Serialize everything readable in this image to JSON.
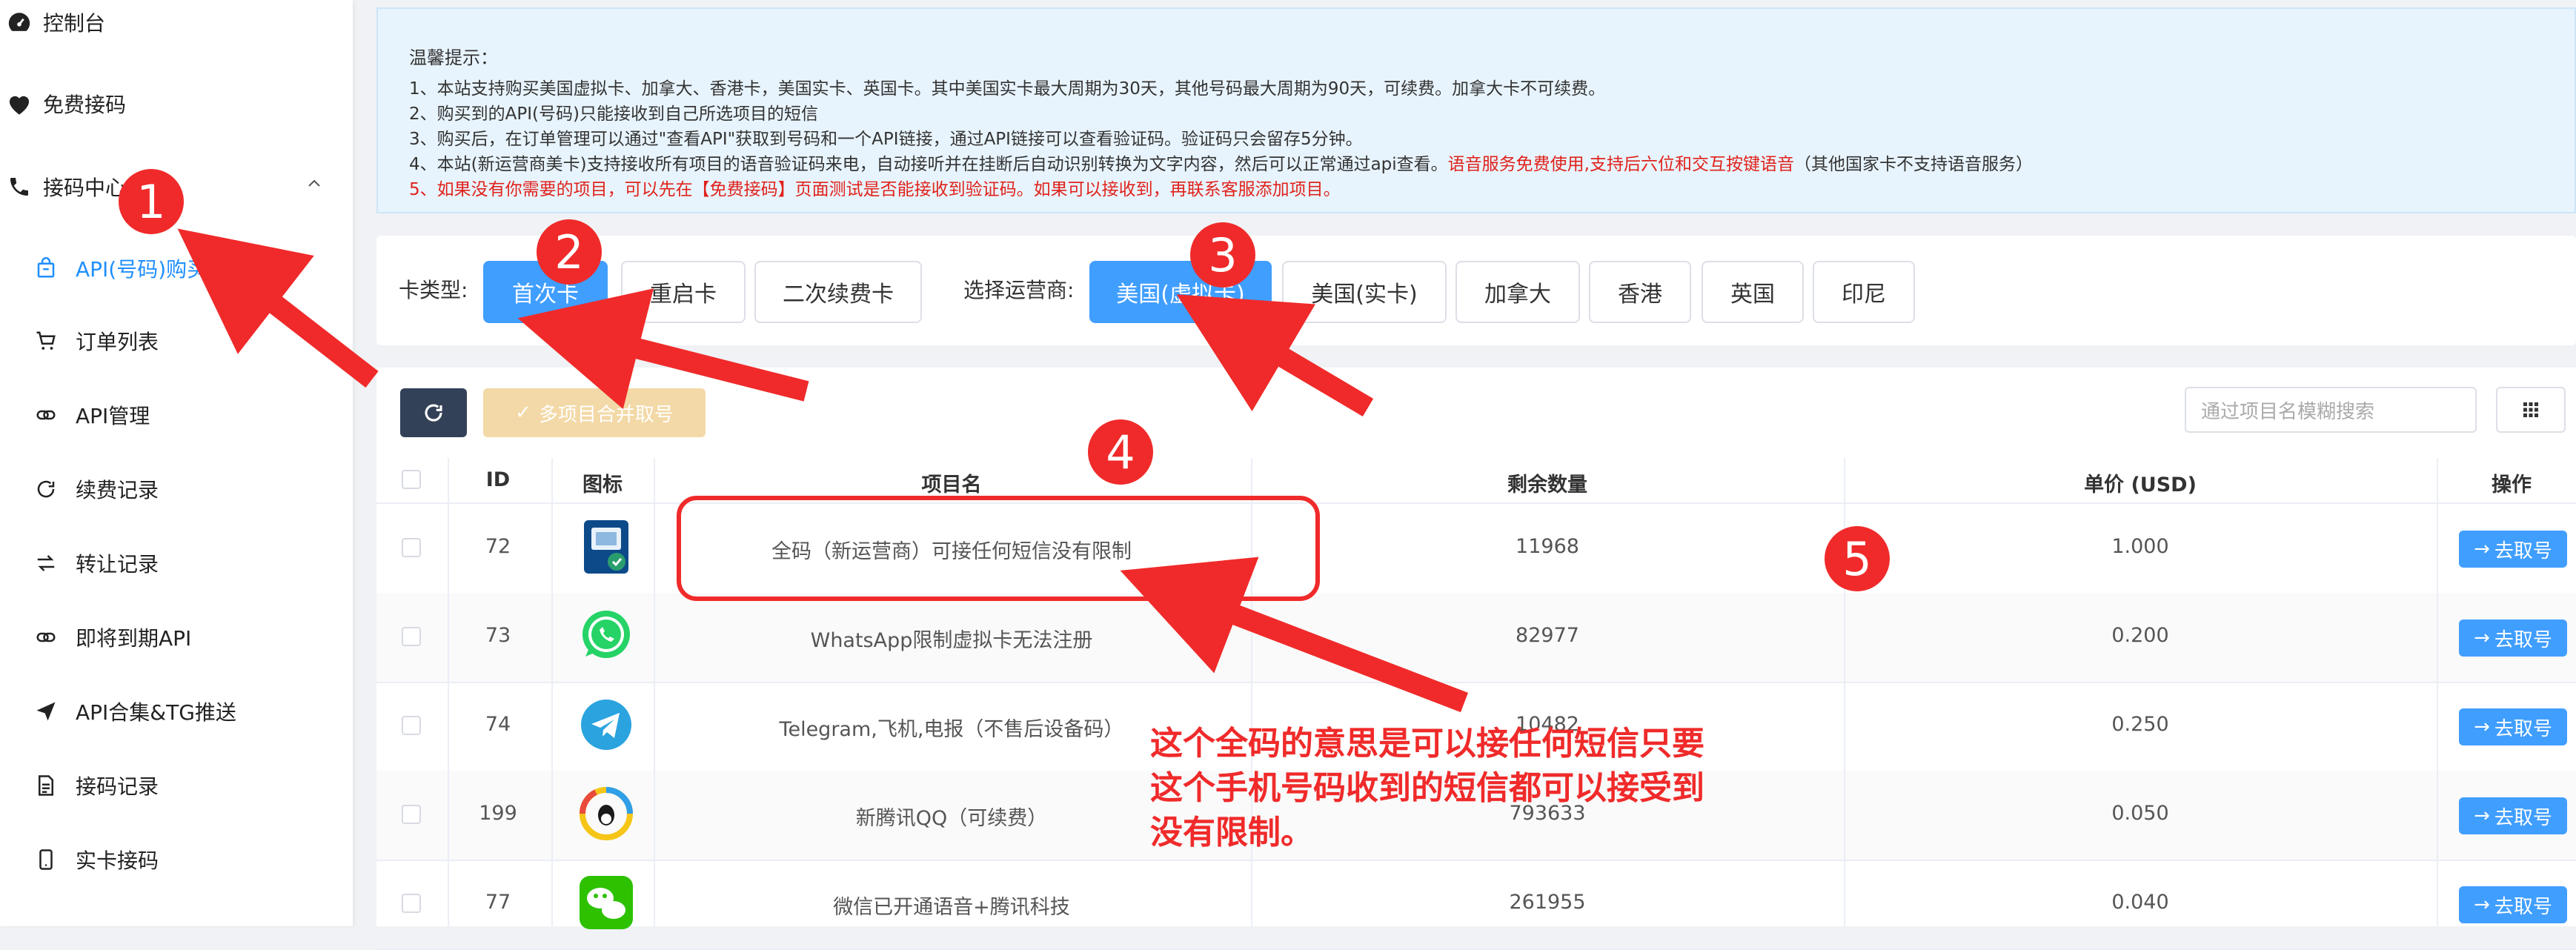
{
  "sidebar": {
    "items": [
      {
        "label": "控制台",
        "icon": "dashboard-icon"
      },
      {
        "label": "免费接码",
        "icon": "heart-icon"
      },
      {
        "label": "接码中心",
        "icon": "phone-icon"
      },
      {
        "label": "API(号码)购买",
        "icon": "bag-icon"
      },
      {
        "label": "订单列表",
        "icon": "cart-icon"
      },
      {
        "label": "API管理",
        "icon": "link-icon"
      },
      {
        "label": "续费记录",
        "icon": "refresh-icon"
      },
      {
        "label": "转让记录",
        "icon": "transfer-icon"
      },
      {
        "label": "即将到期API",
        "icon": "link-icon"
      },
      {
        "label": "API合集&TG推送",
        "icon": "send-icon"
      },
      {
        "label": "接码记录",
        "icon": "document-icon"
      },
      {
        "label": "实卡接码",
        "icon": "mobile-icon"
      }
    ]
  },
  "notice": {
    "title": "温馨提示：",
    "lines": [
      "1、本站支持购买美国虚拟卡、加拿大、香港卡，美国实卡、英国卡。其中美国实卡最大周期为30天，其他号码最大周期为90天，可续费。加拿大卡不可续费。",
      "2、购买到的API(号码)只能接收到自己所选项目的短信",
      "3、购买后，在订单管理可以通过\"查看API\"获取到号码和一个API链接，通过API链接可以查看验证码。验证码只会留存5分钟。",
      "4、本站(新运营商美卡)支持接收所有项目的语音验证码来电，自动接听并在挂断后自动识别转换为文字内容，然后可以正常通过api查看。",
      "5、如果没有你需要的项目，可以先在【免费接码】页面测试是否能接收到验证码。如果可以接收到，再联系客服添加项目。"
    ],
    "line4_red": "语音服务免费使用,支持后六位和交互按键语音",
    "line4_tail": "（其他国家卡不支持语音服务）"
  },
  "filters": {
    "card_type_label": "卡类型:",
    "card_types": [
      "首次卡",
      "重启卡",
      "二次续费卡"
    ],
    "operator_label": "选择运营商:",
    "operators": [
      "美国(虚拟卡)",
      "美国(实卡)",
      "加拿大",
      "香港",
      "英国",
      "印尼"
    ]
  },
  "toolbar": {
    "merge_label": "多项目合并取号",
    "search_placeholder": "通过项目名模糊搜索"
  },
  "table": {
    "headers": {
      "id": "ID",
      "icon": "图标",
      "name": "项目名",
      "remaining": "剩余数量",
      "price": "单价 (USD)",
      "action": "操作"
    },
    "action_label": "去取号",
    "rows": [
      {
        "id": "72",
        "name": "全码（新运营商）可接任何短信没有限制",
        "remaining": "11968",
        "price": "1.000",
        "icon": "sim-card-icon"
      },
      {
        "id": "73",
        "name": "WhatsApp限制虚拟卡无法注册",
        "remaining": "82977",
        "price": "0.200",
        "icon": "whatsapp-icon"
      },
      {
        "id": "74",
        "name": "Telegram,飞机,电报（不售后设备码）",
        "remaining": "10482",
        "price": "0.250",
        "icon": "telegram-icon"
      },
      {
        "id": "199",
        "name": "新腾讯QQ（可续费）",
        "remaining": "793633",
        "price": "0.050",
        "icon": "qq-icon"
      },
      {
        "id": "77",
        "name": "微信已开通语音+腾讯科技",
        "remaining": "261955",
        "price": "0.040",
        "icon": "wechat-icon"
      }
    ]
  },
  "annotations": {
    "badges": [
      "1",
      "2",
      "3",
      "4",
      "5"
    ],
    "note": "这个全码的意思是可以接任何短信只要这个手机号码收到的短信都可以接受到 没有限制。",
    "color": "#f02a2a"
  },
  "colors": {
    "accent": "#409eff",
    "active_text": "#1f8fff",
    "notice_bg": "#e8f4fd"
  }
}
